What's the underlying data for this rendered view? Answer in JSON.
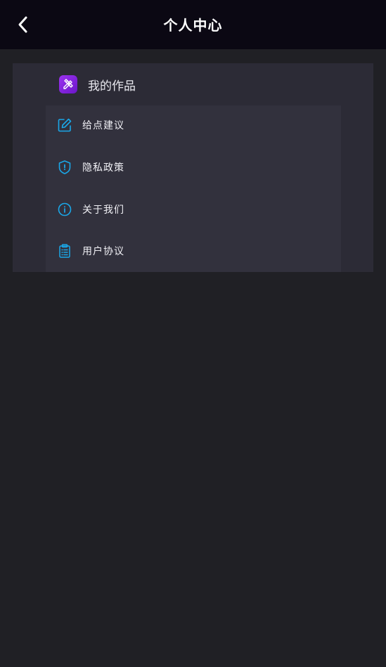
{
  "header": {
    "title": "个人中心",
    "back_icon": "chevron-left-icon"
  },
  "works": {
    "label": "我的作品",
    "icon": "design-tools-icon",
    "icon_color": "#8a28e6"
  },
  "menu": {
    "accent_color": "#1aa7e8",
    "items": [
      {
        "label": "给点建议",
        "icon": "edit-icon"
      },
      {
        "label": "隐私政策",
        "icon": "shield-icon"
      },
      {
        "label": "关于我们",
        "icon": "info-icon"
      },
      {
        "label": "用户协议",
        "icon": "clipboard-icon"
      }
    ]
  },
  "colors": {
    "topbar_bg": "#0b0813",
    "page_bg": "#202025",
    "card_bg": "#2c2b36"
  }
}
